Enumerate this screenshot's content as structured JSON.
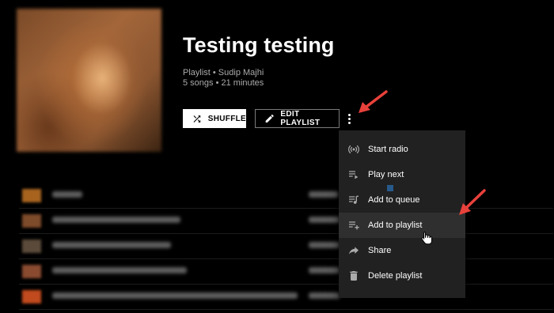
{
  "playlist": {
    "title": "Testing testing",
    "subtitle": "Playlist • Sudip Majhi",
    "meta": "5 songs • 21 minutes"
  },
  "actions": {
    "shuffle_label": "SHUFFLE",
    "edit_label": "EDIT PLAYLIST"
  },
  "menu": {
    "items": [
      {
        "label": "Start radio",
        "icon": "radio-icon"
      },
      {
        "label": "Play next",
        "icon": "play-next-icon"
      },
      {
        "label": "Add to queue",
        "icon": "queue-icon"
      },
      {
        "label": "Add to playlist",
        "icon": "playlist-add-icon"
      },
      {
        "label": "Share",
        "icon": "share-icon"
      },
      {
        "label": "Delete playlist",
        "icon": "trash-icon"
      }
    ],
    "highlighted": "Add to playlist"
  },
  "colors": {
    "background": "#000000",
    "menu_background": "#212121",
    "annotation_arrow": "#e8413b",
    "secondary_text": "#aaaaaa"
  }
}
